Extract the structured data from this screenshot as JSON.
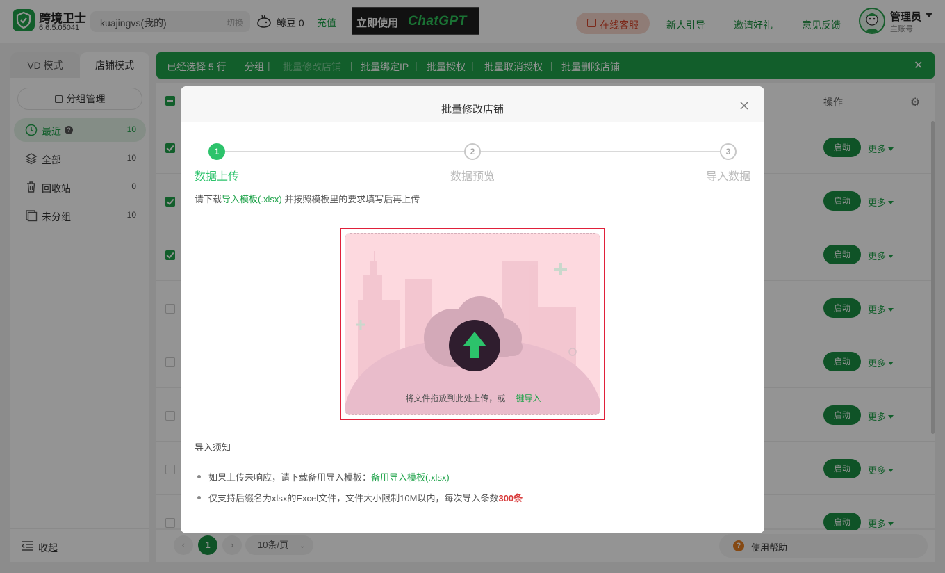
{
  "app": {
    "name": "跨境卫士",
    "version": "6.6.5.05041"
  },
  "account": {
    "name": "kuajingvs(我的)",
    "switch_label": "切换"
  },
  "beans": {
    "label": "鲸豆 0",
    "recharge_label": "充值"
  },
  "banner": {
    "prefix": "立即使用",
    "brand": "ChatGPT"
  },
  "header": {
    "service_label": "在线客服",
    "links": [
      "新人引导",
      "邀请好礼",
      "意见反馈"
    ],
    "user_name": "管理员",
    "user_role": "主账号"
  },
  "mode_tabs": [
    "VD 模式",
    "店铺模式"
  ],
  "sidebar": {
    "group_mgmt_label": "分组管理",
    "items": [
      {
        "label": "最近",
        "count": "10"
      },
      {
        "label": "全部",
        "count": "10"
      },
      {
        "label": "回收站",
        "count": "0"
      },
      {
        "label": "未分组",
        "count": "10"
      }
    ],
    "collapse_label": "收起"
  },
  "batch_bar": {
    "selected_text": "已经选择 5 行",
    "actions": [
      "分组",
      "批量修改店铺",
      "批量绑定IP",
      "批量授权",
      "批量取消授权",
      "批量删除店铺"
    ]
  },
  "table": {
    "ops_header": "操作",
    "start_label": "启动",
    "more_label": "更多",
    "row_checked": [
      true,
      true,
      true,
      false,
      false,
      false,
      false,
      false
    ]
  },
  "pager": {
    "current": "1",
    "page_size": "10条/页",
    "help_label": "使用帮助"
  },
  "modal": {
    "title": "批量修改店铺",
    "steps": [
      {
        "num": "1",
        "label": "数据上传"
      },
      {
        "num": "2",
        "label": "数据预览"
      },
      {
        "num": "3",
        "label": "导入数据"
      }
    ],
    "tip_prefix": "请下载",
    "tip_link": "导入模板(.xlsx)",
    "tip_suffix": " 并按照模板里的要求填写后再上传",
    "upload_text": "将文件拖放到此处上传，或 ",
    "upload_link": "一键导入",
    "notice_title": "导入须知",
    "notice_1_prefix": "如果上传未响应，请下载备用导入模板：",
    "notice_1_link": "备用导入模板(.xlsx)",
    "notice_2_prefix": "仅支持后缀名为xlsx的Excel文件，文件大小限制10M以内，每次导入条数",
    "notice_2_highlight": "300条"
  }
}
